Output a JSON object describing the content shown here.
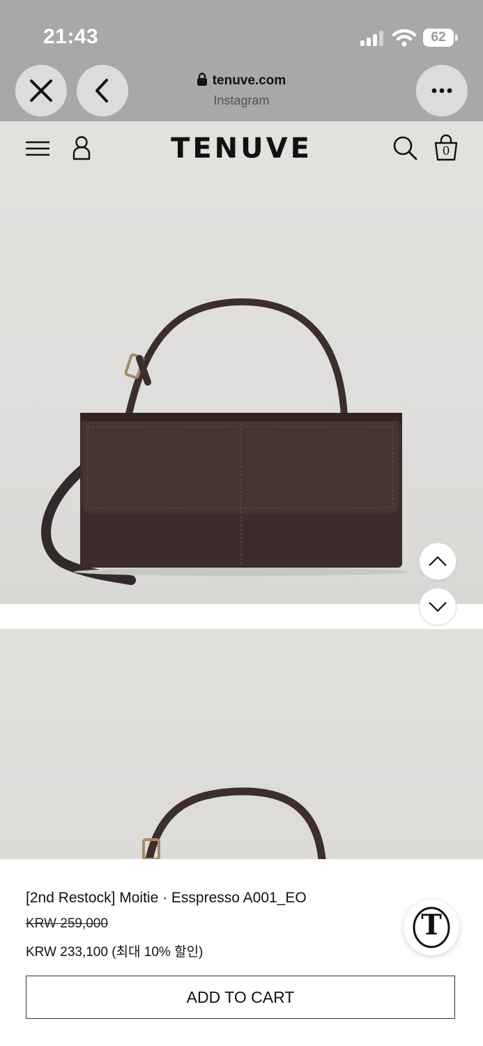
{
  "status_bar": {
    "time": "21:43",
    "battery": "62",
    "icons": [
      "signal-icon",
      "wifi-icon",
      "battery-icon"
    ]
  },
  "browser": {
    "domain": "tenuve.com",
    "source": "Instagram",
    "buttons": [
      "close-icon",
      "back-icon",
      "more-icon"
    ]
  },
  "header": {
    "brand": "TENUVE",
    "cart_count": "0",
    "icons": [
      "menu-icon",
      "account-icon",
      "search-icon",
      "cart-icon"
    ]
  },
  "gallery": {
    "arrows": [
      "chevron-up-icon",
      "chevron-down-icon"
    ]
  },
  "product": {
    "name": "[2nd Restock] Moitie · Esspresso A001_EO",
    "original_price": "KRW 259,000",
    "sale_price": "KRW 233,100 (최대 10% 할인)",
    "add_to_cart": "ADD TO CART",
    "badge_letter": "T"
  },
  "colors": {
    "chrome": "#a8a8a8",
    "page_bg": "#e2e1de",
    "bag": "#3b2e2b"
  }
}
